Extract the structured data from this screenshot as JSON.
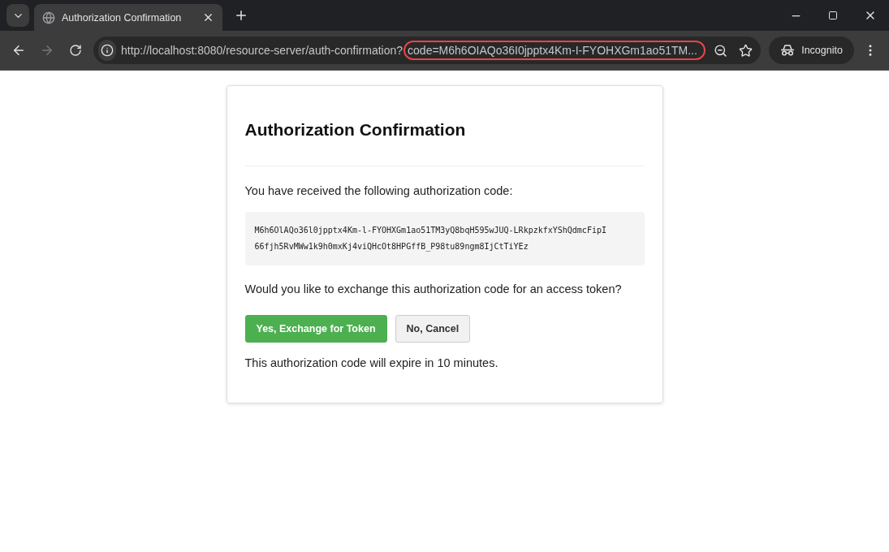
{
  "browser": {
    "tab_title": "Authorization Confirmation",
    "url_base": "http://localhost:8080/resource-server/auth-confirmation?",
    "url_query": "code=M6h6OIAQo36I0jpptx4Km-I-FYOHXGm1ao51TM...",
    "profile": "Incognito"
  },
  "card": {
    "title": "Authorization Confirmation",
    "intro": "You have received the following authorization code:",
    "code_lines": [
      "M6h6OlAQo36l0jpptx4Km-l-FYOHXGm1ao51TM3yQ8bqH595wJUQ-LRkpzkfxYShQdmcFipI",
      "66fjh5RvMWw1k9h0mxKj4viQHcOt8HPGffB_P98tu89ngm8IjCtTiYEz"
    ],
    "question": "Would you like to exchange this authorization code for an access token?",
    "buttons": [
      {
        "label": "Yes, Exchange for Token",
        "kind": "primary"
      },
      {
        "label": "No, Cancel",
        "kind": "secondary"
      }
    ],
    "note": "This authorization code will expire in 10 minutes."
  }
}
